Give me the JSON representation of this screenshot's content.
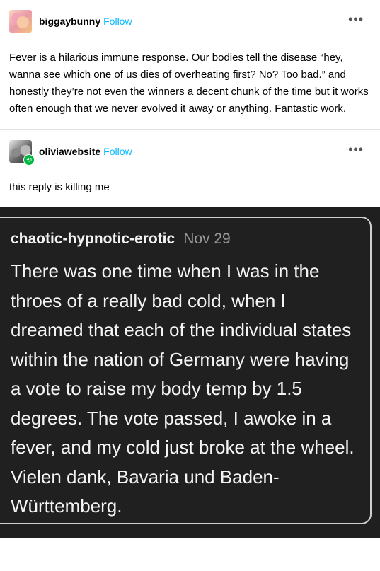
{
  "posts": [
    {
      "username": "biggaybunny",
      "follow_label": "Follow",
      "more_icon": "more-horizontal-icon",
      "body": "Fever is a hilarious immune response. Our bodies tell the disease “hey, wanna see which one of us dies of overheating first? No? Too bad.” and honestly they’re not even the winners a decent chunk of the time but it works often enough that we never evolved it away or anything. Fantastic work."
    },
    {
      "username": "oliviawebsite",
      "follow_label": "Follow",
      "more_icon": "more-horizontal-icon",
      "badge_icon": "reblog-icon",
      "body": "this reply is killing me"
    }
  ],
  "embedded_image": {
    "author": "chaotic-hypnotic-erotic",
    "date": "Nov 29",
    "text": "There was one time when I was in the throes of a really bad cold, when I dreamed that each of the individual states within the nation of Germany were having a vote to raise my body temp by 1.5 degrees. The vote passed, I awoke in a fever, and my cold just broke at the wheel. Vielen dank, Bavaria und Baden-Württemberg."
  },
  "colors": {
    "follow": "#00b8ff",
    "reblog_badge": "#00b83f",
    "embed_bg": "#1f1f1f"
  }
}
